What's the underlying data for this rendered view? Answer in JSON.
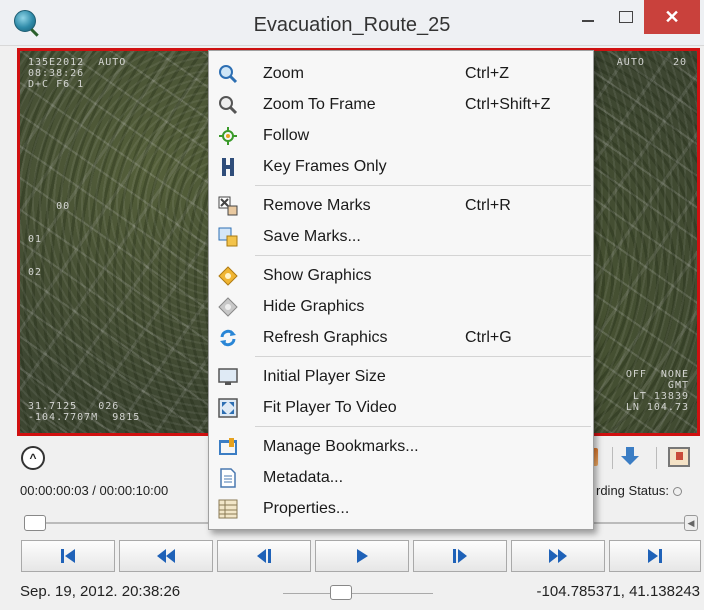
{
  "window": {
    "title": "Evacuation_Route_25",
    "close_glyph": "✕"
  },
  "video": {
    "osd_top_left": "135E2012  AUTO\n08:38:26\nD+C F6 1",
    "osd_top_right": "AUTO    20",
    "osd_left_marks": "    00\n\n\n01\n\n\n02",
    "osd_bottom_left": "31.7125   026\n-104.7707M  9815",
    "osd_bottom_right": "OFF  NONE\n   GMT\nLT 13839\nLN 104.73"
  },
  "context_menu": {
    "items": [
      {
        "label": "Zoom",
        "shortcut": "Ctrl+Z",
        "icon": "magnifier-icon"
      },
      {
        "label": "Zoom To Frame",
        "shortcut": "Ctrl+Shift+Z",
        "icon": "magnifier-frame-icon"
      },
      {
        "label": "Follow",
        "shortcut": "",
        "icon": "crosshair-icon"
      },
      {
        "label": "Key Frames Only",
        "shortcut": "",
        "icon": "key-frame-icon"
      },
      {
        "label": "Remove Marks",
        "shortcut": "Ctrl+R",
        "icon": "remove-marks-icon"
      },
      {
        "label": "Save Marks...",
        "shortcut": "",
        "icon": "save-marks-icon"
      },
      {
        "label": "Show Graphics",
        "shortcut": "",
        "icon": "show-graphics-icon"
      },
      {
        "label": "Hide Graphics",
        "shortcut": "",
        "icon": "hide-graphics-icon"
      },
      {
        "label": "Refresh Graphics",
        "shortcut": "Ctrl+G",
        "icon": "refresh-icon"
      },
      {
        "label": "Initial Player Size",
        "shortcut": "",
        "icon": "monitor-icon"
      },
      {
        "label": "Fit Player To Video",
        "shortcut": "",
        "icon": "fit-screen-icon"
      },
      {
        "label": "Manage Bookmarks...",
        "shortcut": "",
        "icon": "bookmarks-icon"
      },
      {
        "label": "Metadata...",
        "shortcut": "",
        "icon": "document-icon"
      },
      {
        "label": "Properties...",
        "shortcut": "",
        "icon": "properties-icon"
      }
    ]
  },
  "player": {
    "collapse_glyph": "^",
    "time_display": "00:00:00:03 / 00:00:10:00",
    "recording_status_label": "rding Status:",
    "seek_end_glyph": "◀"
  },
  "statusbar": {
    "date": "Sep. 19, 2012. 20:38:26",
    "coordinates": "-104.785371, 41.138243"
  },
  "colors": {
    "accent": "#1f62b8",
    "video_border": "#d01010",
    "close_button": "#c9413c"
  }
}
